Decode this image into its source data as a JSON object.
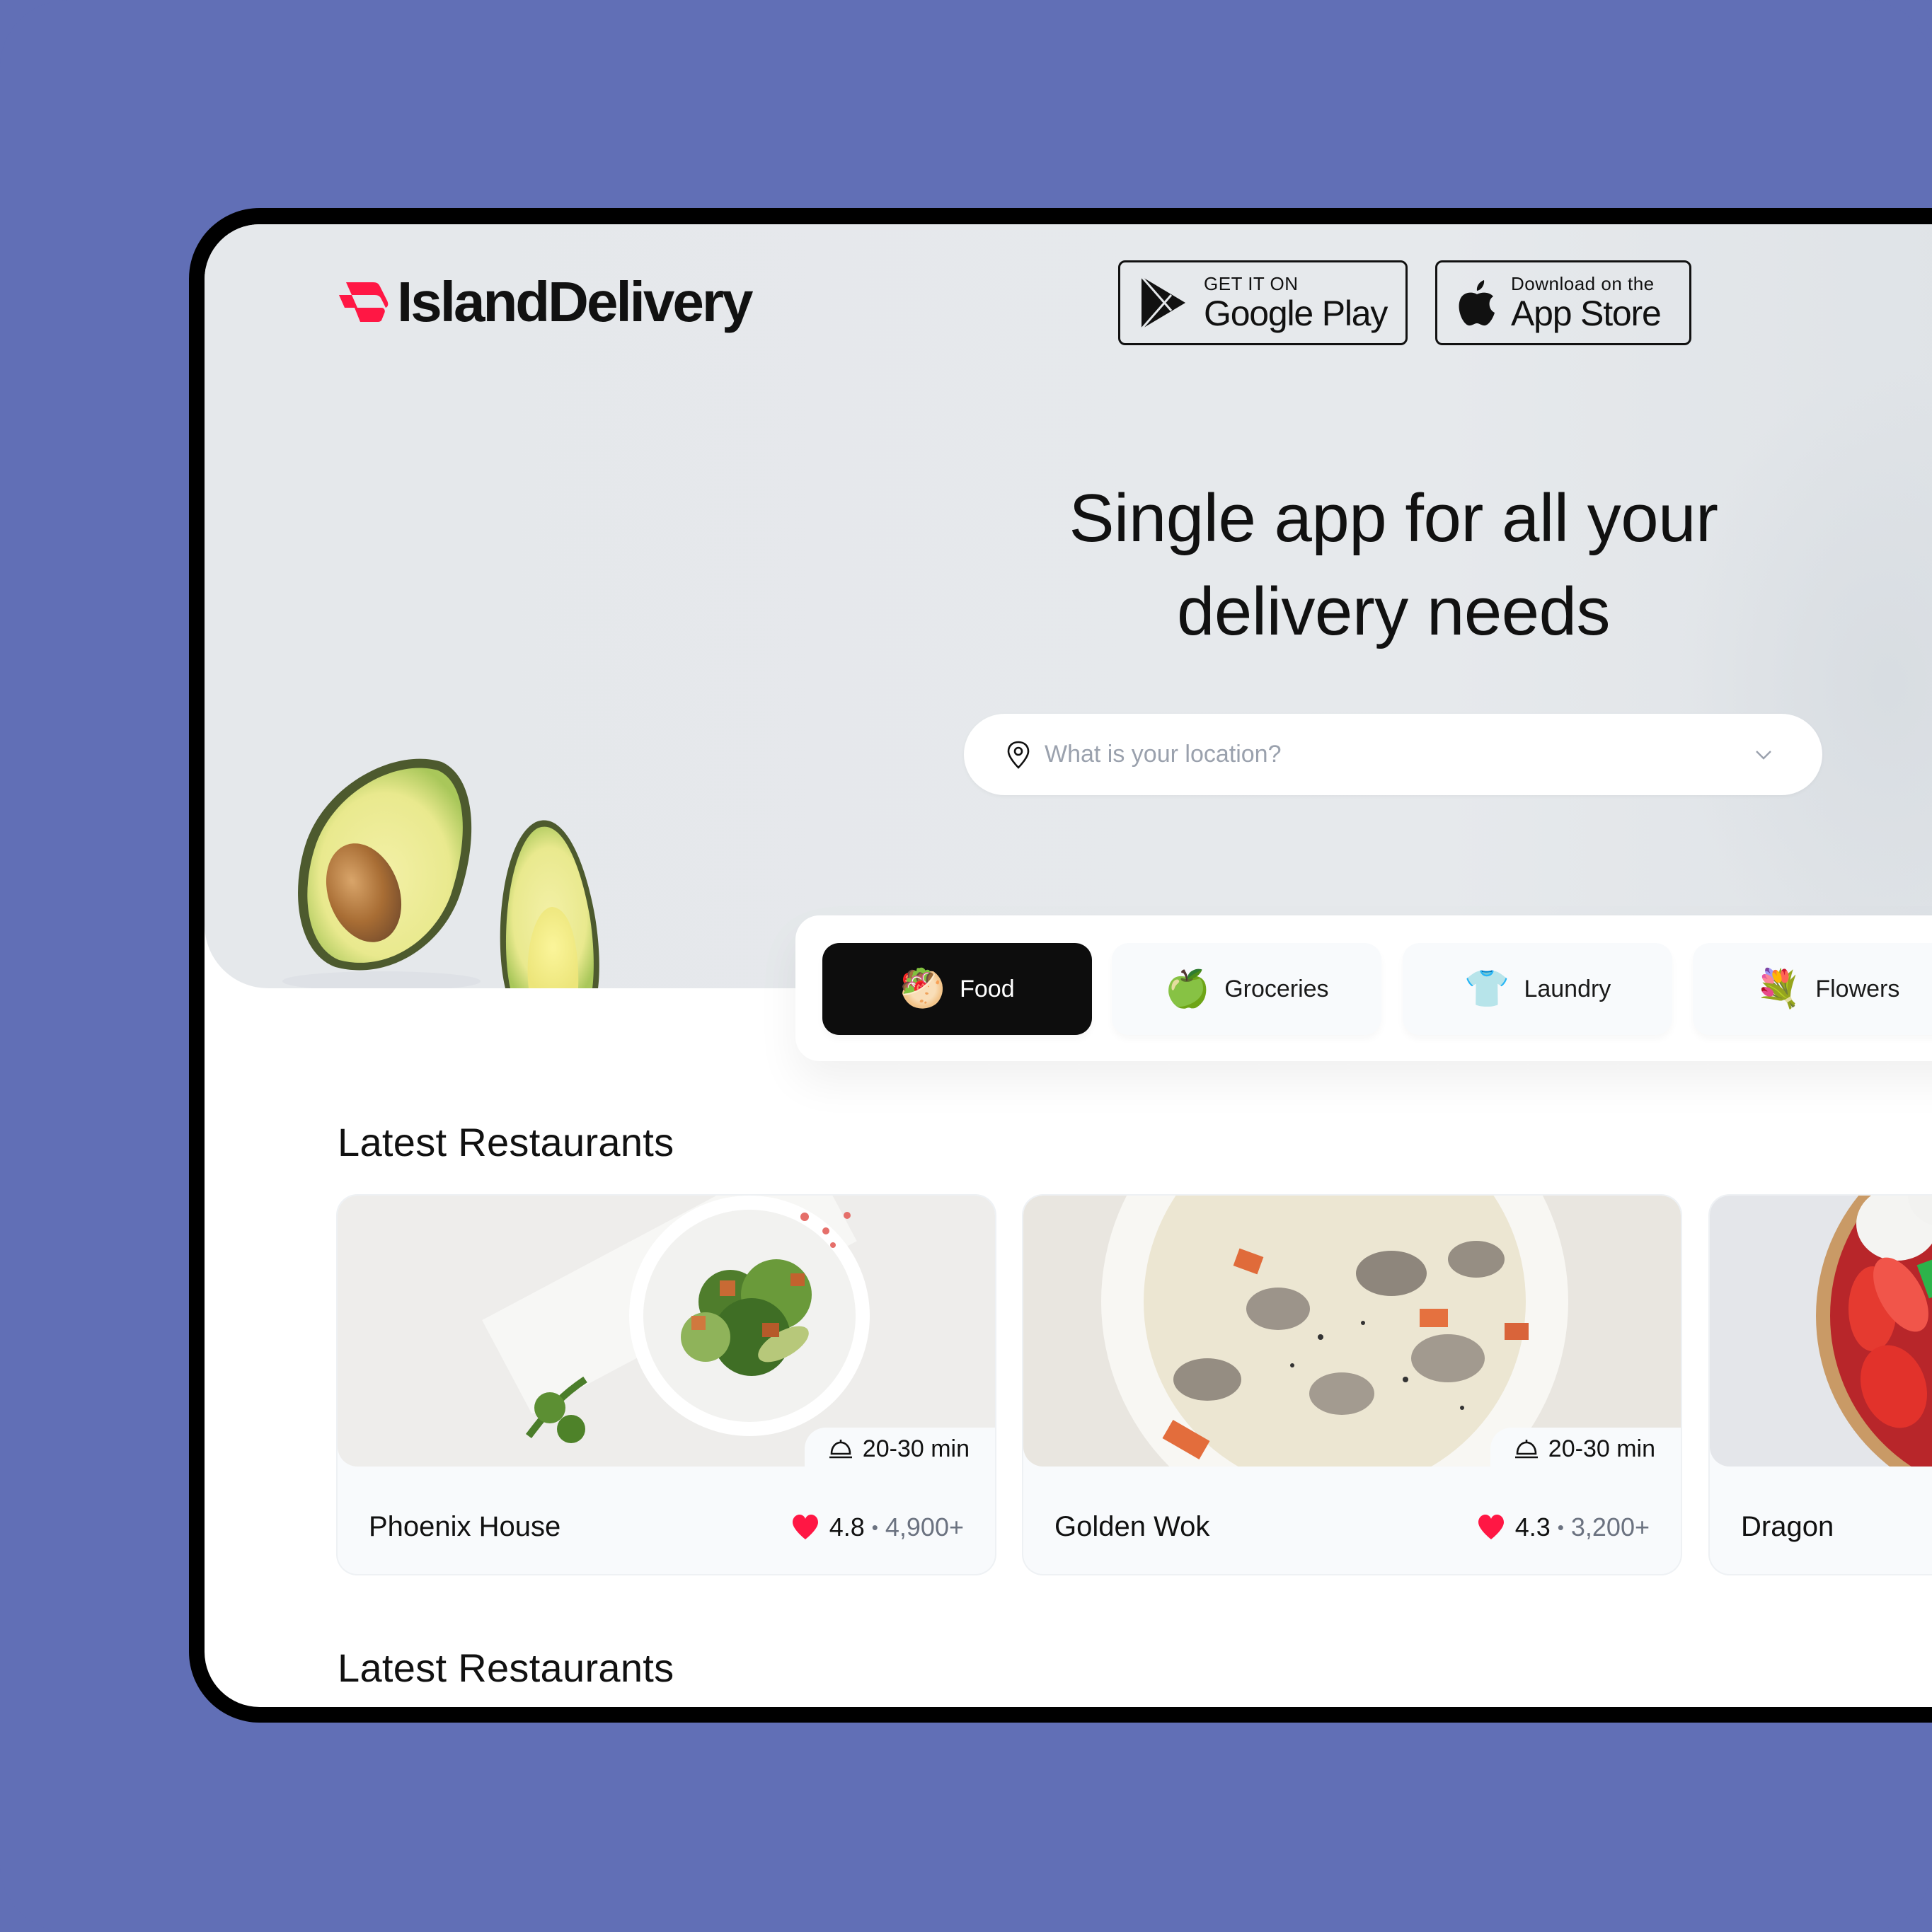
{
  "brand": {
    "name": "IslandDelivery",
    "accent_color": "#ff1744",
    "background_color": "#616fb6"
  },
  "store_buttons": {
    "google_play": {
      "small": "GET IT ON",
      "big": "Google Play",
      "icon": "google-play-icon"
    },
    "app_store": {
      "small": "Download on the",
      "big": "App Store",
      "icon": "apple-icon"
    }
  },
  "hero": {
    "headline_line1": "Single app for all your",
    "headline_line2": "delivery needs",
    "search": {
      "placeholder": "What is your location?",
      "value": "",
      "icon": "location-pin-icon",
      "dropdown_icon": "chevron-down-icon"
    }
  },
  "categories": [
    {
      "label": "Food",
      "emoji": "🥙",
      "active": true
    },
    {
      "label": "Groceries",
      "emoji": "🍏",
      "active": false
    },
    {
      "label": "Laundry",
      "emoji": "👕",
      "active": false
    },
    {
      "label": "Flowers",
      "emoji": "💐",
      "active": false
    }
  ],
  "sections": [
    {
      "title": "Latest Restaurants",
      "restaurants": [
        {
          "name": "Phoenix House",
          "delivery_time": "20-30 min",
          "rating": "4.8",
          "reviews": "4,900+"
        },
        {
          "name": "Golden Wok",
          "delivery_time": "20-30 min",
          "rating": "4.3",
          "reviews": "3,200+"
        },
        {
          "name": "Dragon",
          "delivery_time": "",
          "rating": "",
          "reviews": ""
        }
      ]
    },
    {
      "title": "Latest Restaurants"
    }
  ]
}
